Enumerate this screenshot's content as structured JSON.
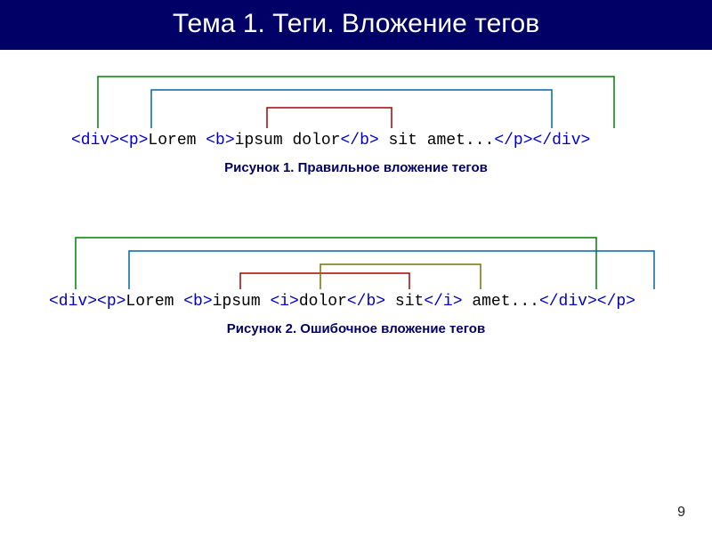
{
  "header": {
    "title": "Тема 1. Теги. Вложение тегов"
  },
  "fig1": {
    "caption": "Рисунок 1. Правильное вложение тегов",
    "tokens": {
      "t1": "<div>",
      "t2": "<p>",
      "t3": "Lorem ",
      "t4": "<b>",
      "t5": "ipsum dolor",
      "t6": "</b>",
      "t7": " sit amet...",
      "t8": "</p>",
      "t9": "</div>"
    }
  },
  "fig2": {
    "caption": "Рисунок 2. Ошибочное вложение тегов",
    "tokens": {
      "t1": "<div>",
      "t2": "<p>",
      "t3": "Lorem ",
      "t4": "<b>",
      "t5": "ipsum ",
      "t6": "<i>",
      "t7": "dolor",
      "t8": "</b>",
      "t9": " sit",
      "t10": "</i>",
      "t11": " amet...",
      "t12": "</div>",
      "t13": "</p>"
    }
  },
  "page_number": "9"
}
